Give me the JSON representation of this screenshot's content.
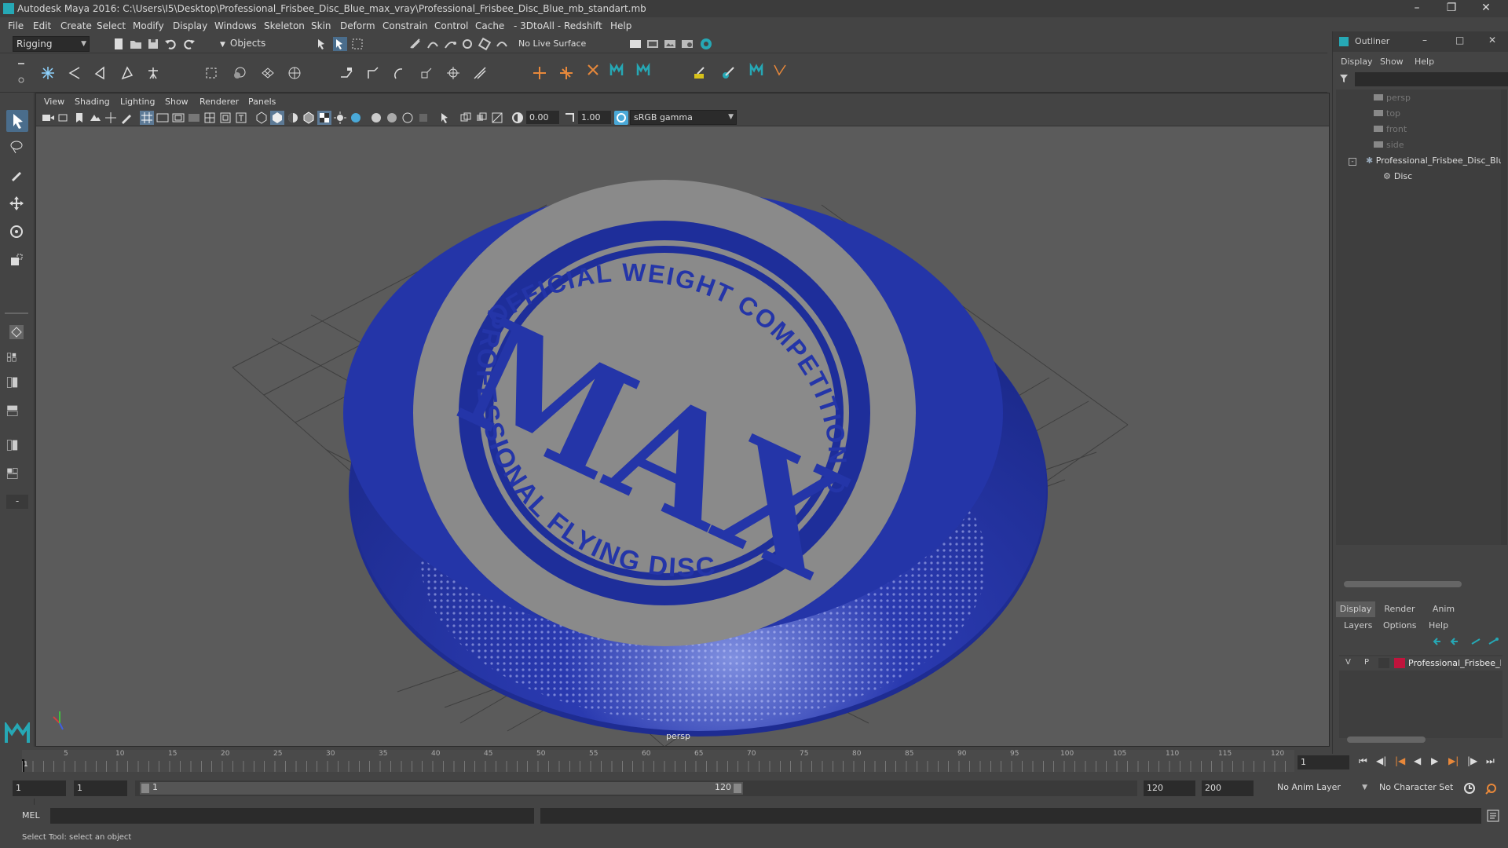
{
  "window": {
    "title": "Autodesk Maya 2016: C:\\Users\\I5\\Desktop\\Professional_Frisbee_Disc_Blue_max_vray\\Professional_Frisbee_Disc_Blue_mb_standart.mb"
  },
  "menu": [
    "File",
    "Edit",
    "Create",
    "Select",
    "Modify",
    "Display",
    "Windows",
    "Skeleton",
    "Skin",
    "Deform",
    "Constrain",
    "Control",
    "Cache",
    "- 3DtoAll -",
    "Redshift",
    "Help"
  ],
  "status_line": {
    "mode": "Rigging",
    "selection_mask": "Objects",
    "live_surface": "No Live Surface"
  },
  "viewport": {
    "menu": [
      "View",
      "Shading",
      "Lighting",
      "Show",
      "Renderer",
      "Panels"
    ],
    "exposure": "0.00",
    "gamma": "1.00",
    "color_space": "sRGB gamma",
    "camera_label": "persp"
  },
  "disc_print": {
    "top_arc": "OFFICIAL WEIGHT COMPETITION DISC",
    "bottom_arc": "PROFESSIONAL FLYING DISC",
    "logo": "MAX"
  },
  "outliner": {
    "title": "Outliner",
    "menu": [
      "Display",
      "Show",
      "Help"
    ],
    "items": [
      {
        "label": "persp",
        "dim": true
      },
      {
        "label": "top",
        "dim": true
      },
      {
        "label": "front",
        "dim": true
      },
      {
        "label": "side",
        "dim": true
      },
      {
        "label": "Professional_Frisbee_Disc_Blu",
        "dim": false
      },
      {
        "label": "Disc",
        "dim": false
      }
    ]
  },
  "layer_editor": {
    "tabs": [
      "Display",
      "Render",
      "Anim"
    ],
    "active_tab": "Display",
    "menu": [
      "Layers",
      "Options",
      "Help"
    ],
    "layer": {
      "v": "V",
      "p": "P",
      "name": "Professional_Frisbee_D",
      "color": "#c0143c"
    }
  },
  "timeline": {
    "ticks": [
      "5",
      "10",
      "15",
      "20",
      "25",
      "30",
      "35",
      "40",
      "45",
      "50",
      "55",
      "60",
      "65",
      "70",
      "75",
      "80",
      "85",
      "90",
      "95",
      "100",
      "105",
      "110",
      "115",
      "120"
    ],
    "start_marker": "1",
    "current_frame": "1"
  },
  "range": {
    "start": "1",
    "playback_start": "1",
    "slider_start": "1",
    "slider_end": "120",
    "playback_end": "120",
    "end": "200",
    "anim_layer": "No Anim Layer",
    "char_set": "No Character Set"
  },
  "command_line": {
    "label": "MEL"
  },
  "help_line": {
    "text": "Select Tool: select an object"
  }
}
